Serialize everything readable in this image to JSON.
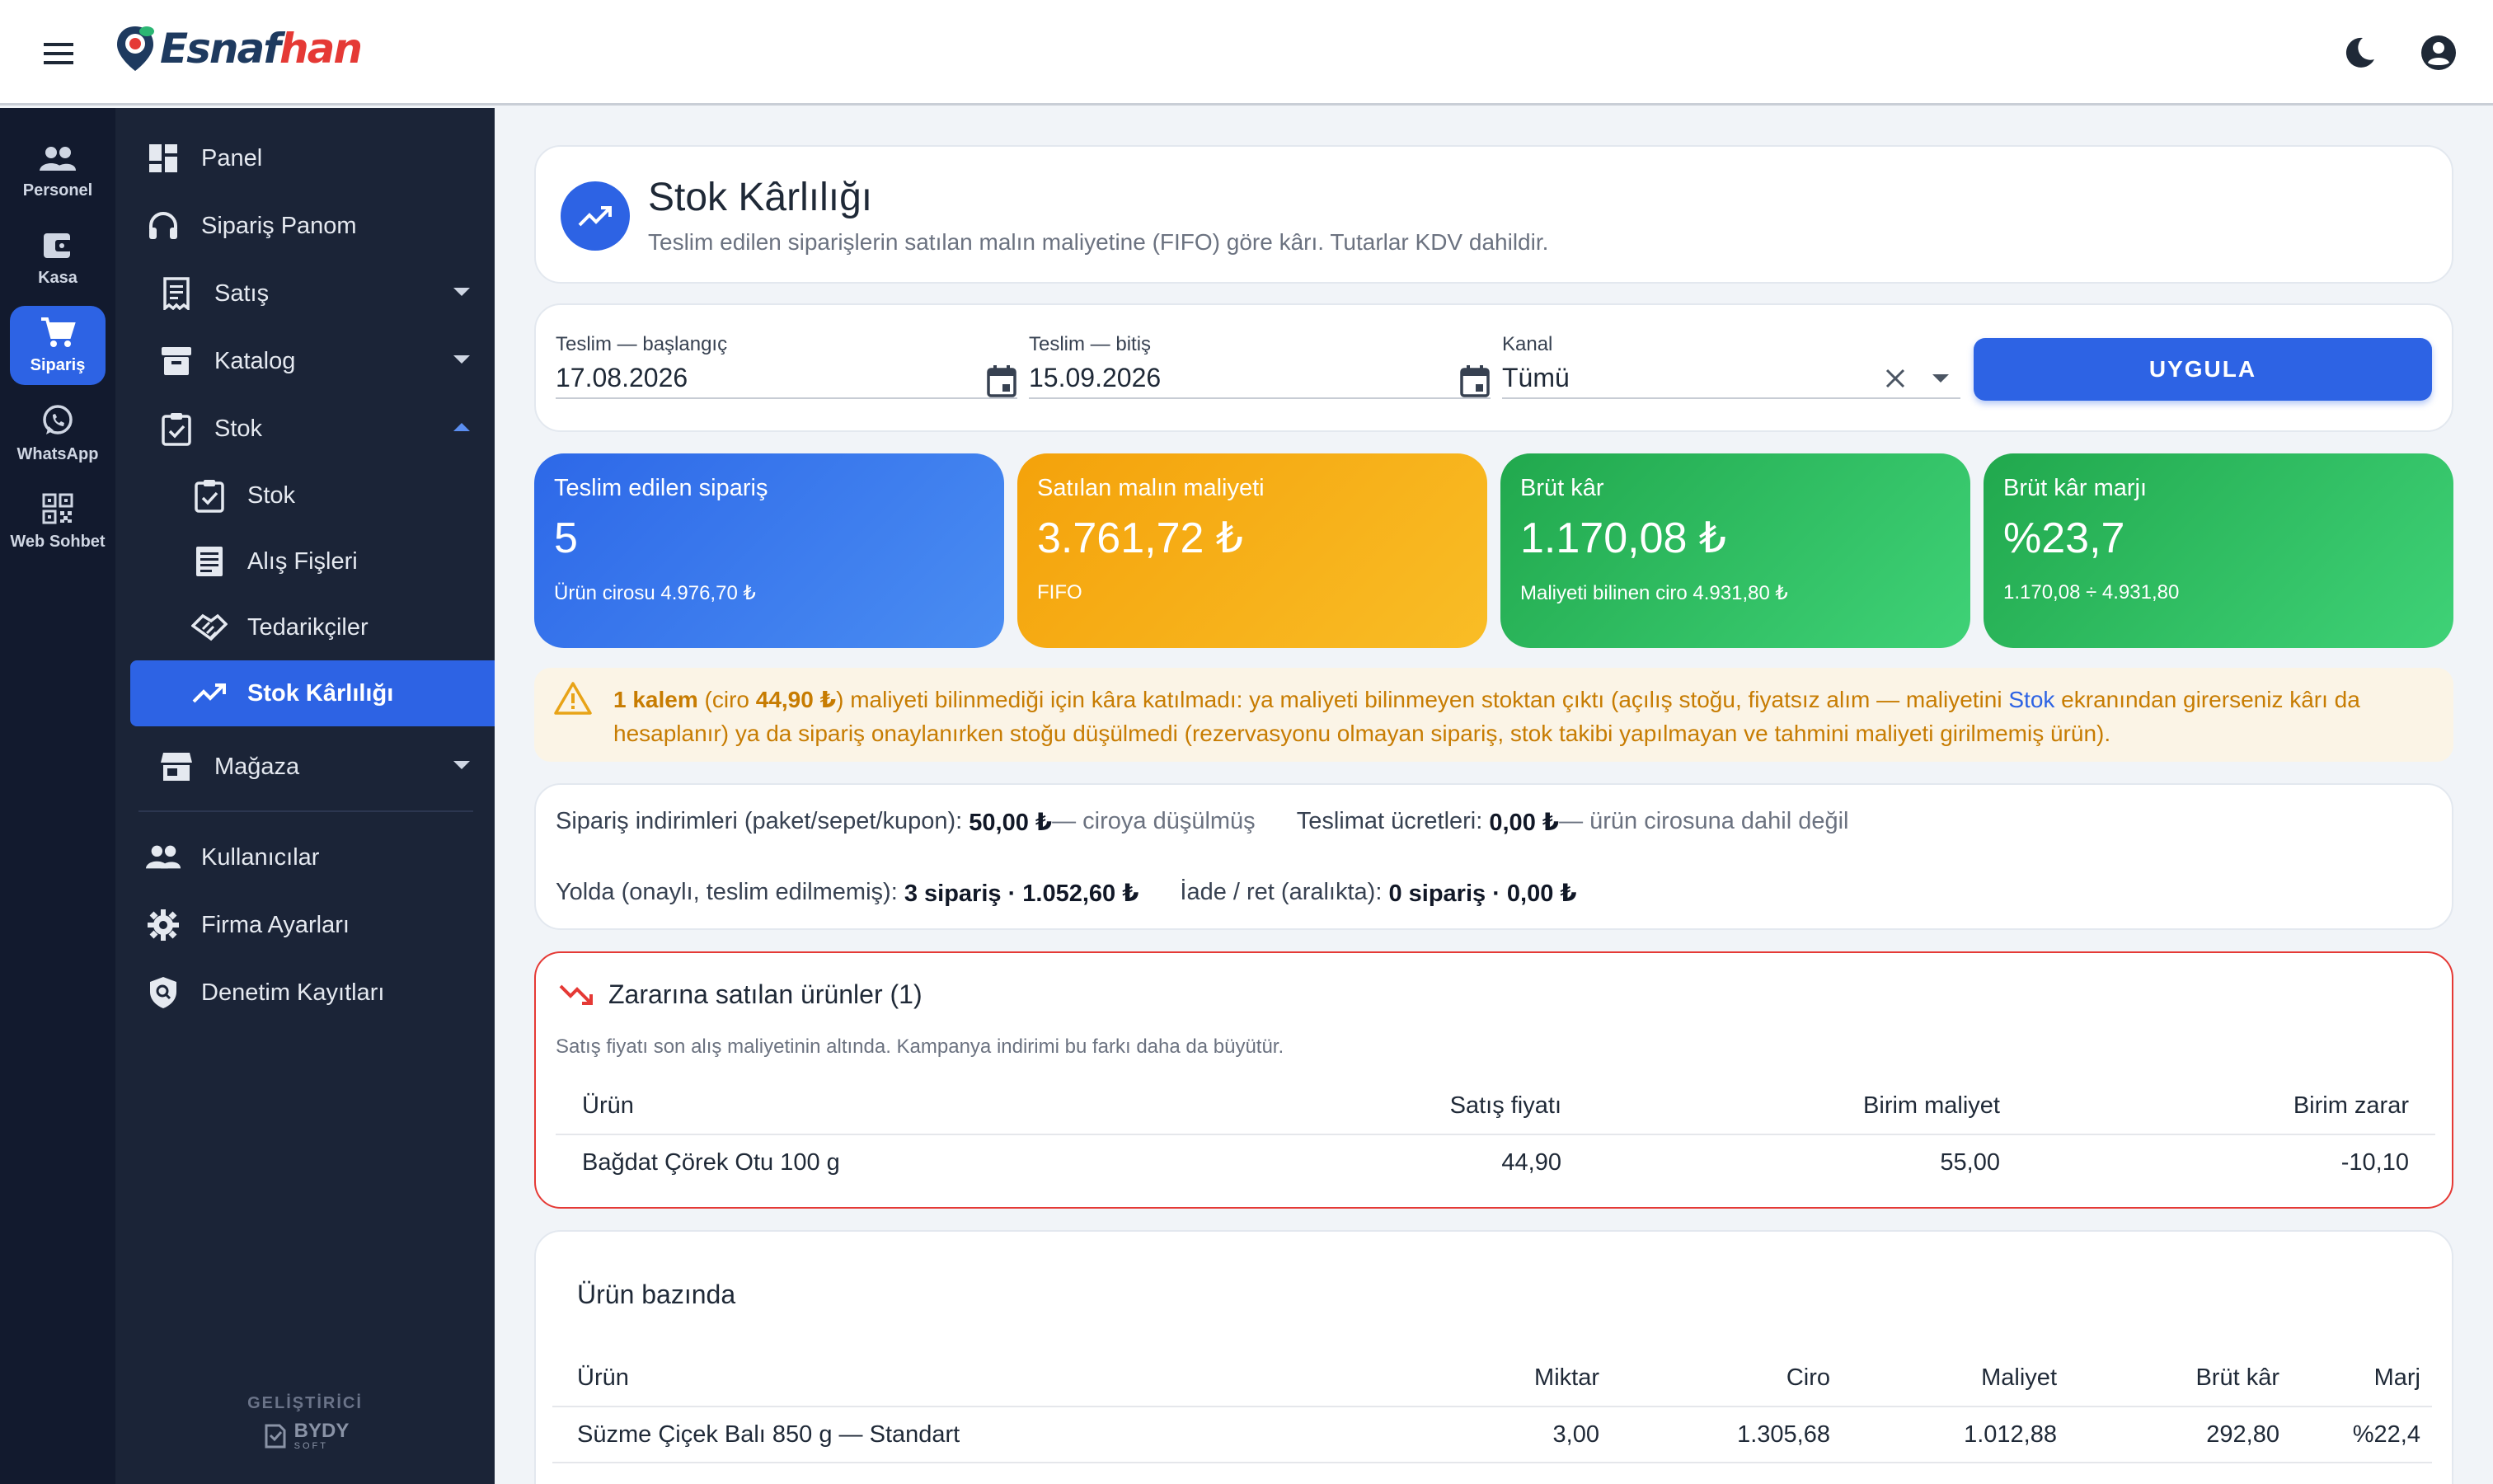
{
  "header": {
    "logo_a": "Esnaf",
    "logo_b": "han"
  },
  "rail": [
    {
      "label": "Personel",
      "icon": "people-icon",
      "active": false
    },
    {
      "label": "Kasa",
      "icon": "wallet-icon",
      "active": false
    },
    {
      "label": "Sipariş",
      "icon": "cart-icon",
      "active": true
    },
    {
      "label": "WhatsApp",
      "icon": "whatsapp-icon",
      "active": false
    },
    {
      "label": "Web Sohbet",
      "icon": "qr-icon",
      "active": false
    }
  ],
  "sidebar": {
    "items": [
      {
        "label": "Panel"
      },
      {
        "label": "Sipariş Panom"
      },
      {
        "label": "Satış"
      },
      {
        "label": "Katalog"
      },
      {
        "label": "Stok"
      },
      {
        "label": "Stok"
      },
      {
        "label": "Alış Fişleri"
      },
      {
        "label": "Tedarikçiler"
      },
      {
        "label": "Stok Kârlılığı"
      },
      {
        "label": "Mağaza"
      },
      {
        "label": "Kullanıcılar"
      },
      {
        "label": "Firma Ayarları"
      },
      {
        "label": "Denetim Kayıtları"
      }
    ],
    "footer_label": "GELİŞTİRİCİ",
    "footer_brand": "BYDY",
    "footer_brand_sub": "SOFT"
  },
  "page": {
    "title": "Stok Kârlılığı",
    "subtitle": "Teslim edilen siparişlerin satılan malın maliyetine (FIFO) göre kârı. Tutarlar KDV dahildir."
  },
  "filters": {
    "start_label": "Teslim — başlangıç",
    "start_value": "17.08.2026",
    "end_label": "Teslim — bitiş",
    "end_value": "15.09.2026",
    "channel_label": "Kanal",
    "channel_value": "Tümü",
    "apply_label": "UYGULA"
  },
  "stats": [
    {
      "label": "Teslim edilen sipariş",
      "value": "5",
      "sub": "Ürün cirosu 4.976,70 ₺"
    },
    {
      "label": "Satılan malın maliyeti",
      "value": "3.761,72 ₺",
      "sub": "FIFO"
    },
    {
      "label": "Brüt kâr",
      "value": "1.170,08 ₺",
      "sub": "Maliyeti bilinen ciro 4.931,80 ₺"
    },
    {
      "label": "Brüt kâr marjı",
      "value": "%23,7",
      "sub": "1.170,08 ÷ 4.931,80"
    }
  ],
  "warning": {
    "bold1": "1 kalem",
    "t1": " (ciro ",
    "bold2": "44,90 ₺",
    "t2": ") maliyeti bilinmediği için kâra katılmadı: ya maliyeti bilinmeyen stoktan çıktı (açılış stoğu, fiyatsız alım — maliyetini ",
    "link": "Stok",
    "t3": " ekranından girerseniz kârı da hesaplanır) ya da sipariş onaylanırken stoğu düşülmedi (rezervasyonu olmayan sipariş, stok takibi yapılmayan ve tahmini maliyeti girilmemiş ürün)."
  },
  "info": {
    "discount_label": "Sipariş indirimleri (paket/sepet/kupon): ",
    "discount_value": "50,00 ₺",
    "discount_note": " — ciroya düşülmüş",
    "shipping_label": "Teslimat ücretleri: ",
    "shipping_value": "0,00 ₺",
    "shipping_note": " — ürün cirosuna dahil değil",
    "transit_label": "Yolda (onaylı, teslim edilmemiş): ",
    "transit_value": "3 sipariş · 1.052,60 ₺",
    "returns_label": "İade / ret (aralıkta): ",
    "returns_value": "0 sipariş · 0,00 ₺"
  },
  "loss": {
    "title": "Zararına satılan ürünler (1)",
    "subtitle": "Satış fiyatı son alış maliyetinin altında. Kampanya indirimi bu farkı daha da büyütür.",
    "headers": [
      "Ürün",
      "Satış fiyatı",
      "Birim maliyet",
      "Birim zarar"
    ],
    "rows": [
      {
        "product": "Bağdat Çörek Otu 100 g",
        "price": "44,90",
        "cost": "55,00",
        "loss": "-10,10"
      }
    ]
  },
  "products": {
    "title": "Ürün bazında",
    "headers": [
      "Ürün",
      "Miktar",
      "Ciro",
      "Maliyet",
      "Brüt kâr",
      "Marj"
    ],
    "rows": [
      {
        "product": "Süzme Çiçek Balı 850 g — Standart",
        "qty": "3,00",
        "revenue": "1.305,68",
        "cost": "1.012,88",
        "profit": "292,80",
        "margin": "%22,4"
      }
    ]
  },
  "colors": {
    "primary": "#2d63e4",
    "rail_bg": "#121a2e",
    "sidebar_bg": "#1b2437",
    "warning": "#c77c02",
    "danger": "#e53935"
  }
}
